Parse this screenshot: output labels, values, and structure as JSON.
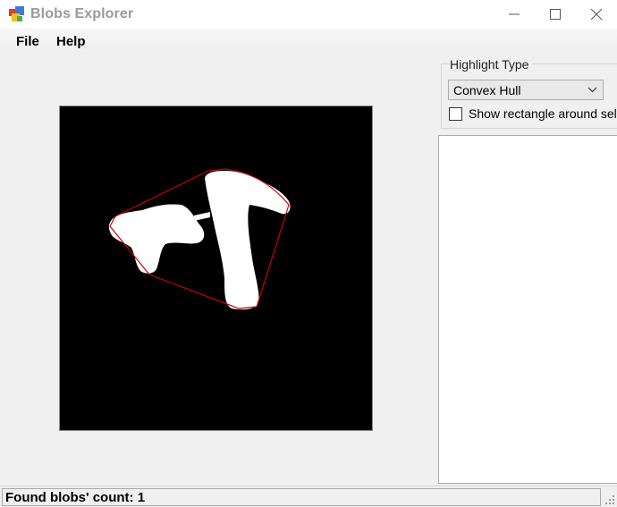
{
  "window": {
    "title": "Blobs Explorer",
    "icon": "app-icon",
    "controls": [
      "minimize-icon",
      "maximize-icon",
      "close-icon"
    ]
  },
  "menu": {
    "file": "File",
    "help": "Help"
  },
  "highlight": {
    "group_label": "Highlight Type",
    "selected": "Convex Hull",
    "show_rect_label": "Show rectangle around selected blob",
    "show_rect_checked": false
  },
  "colors": {
    "hull_stroke": "#cc0000",
    "blob_fill": "#ffffff",
    "canvas_bg": "#000000"
  },
  "status": {
    "text": "Found blobs' count: 1"
  }
}
